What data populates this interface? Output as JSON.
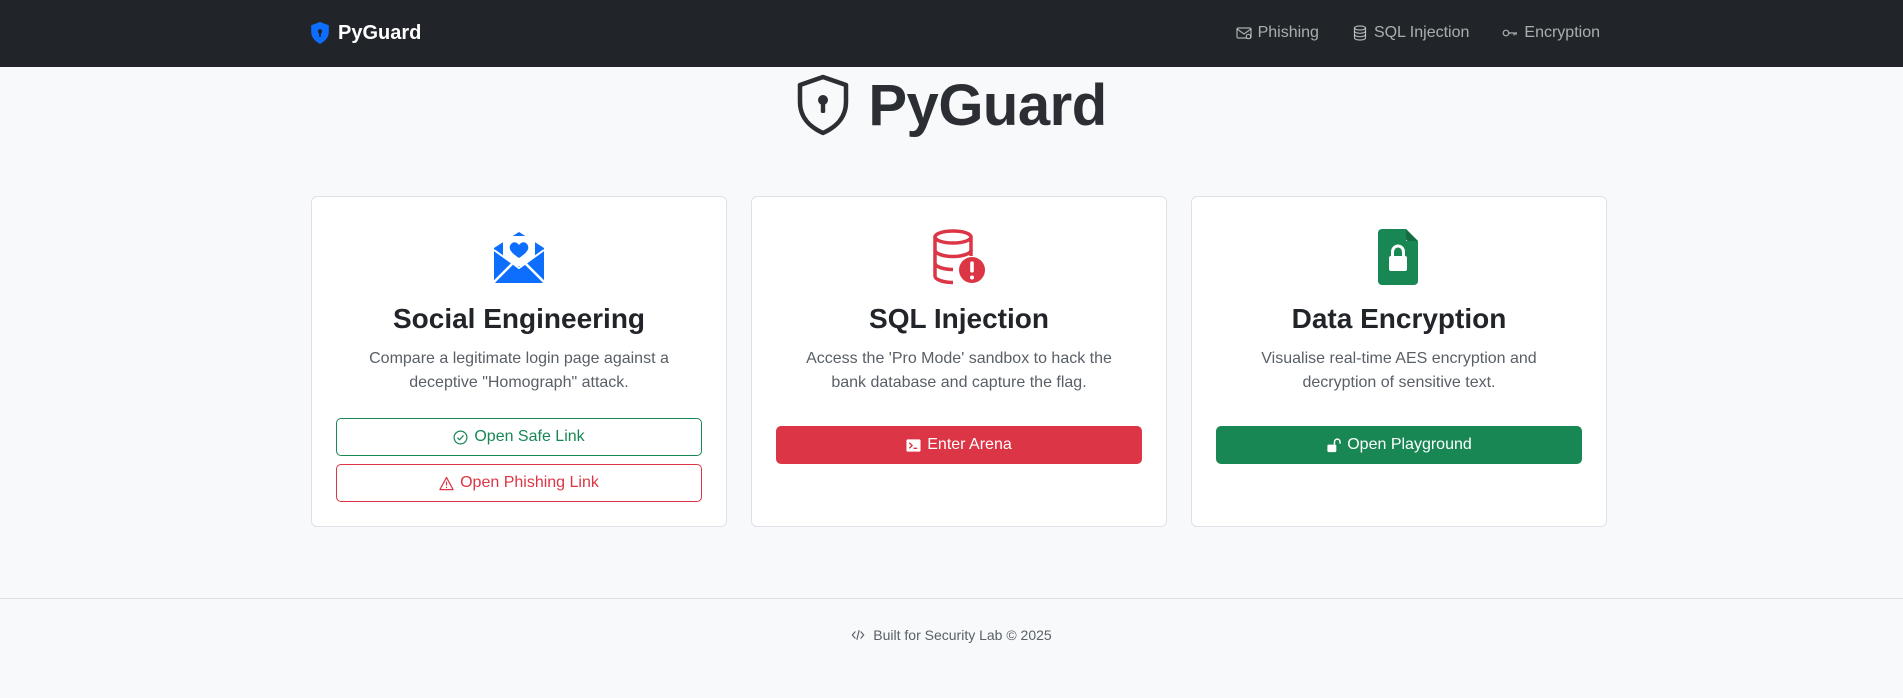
{
  "navbar": {
    "brand": "PyGuard",
    "links": [
      {
        "label": "Phishing",
        "icon": "envelope-icon"
      },
      {
        "label": "SQL Injection",
        "icon": "database-icon"
      },
      {
        "label": "Encryption",
        "icon": "key-icon"
      }
    ]
  },
  "hero": {
    "title": "PyGuard",
    "icon": "shield-lock-icon"
  },
  "cards": [
    {
      "title": "Social Engineering",
      "description": "Compare a legitimate login page against a deceptive \"Homograph\" attack.",
      "icon": "envelope-heart-icon",
      "icon_color": "#0d6efd",
      "buttons": [
        {
          "label": "Open Safe Link",
          "icon": "check-circle-icon"
        },
        {
          "label": "Open Phishing Link",
          "icon": "warning-icon"
        }
      ]
    },
    {
      "title": "SQL Injection",
      "description": "Access the 'Pro Mode' sandbox to hack the bank database and capture the flag.",
      "icon": "database-exclamation-icon",
      "icon_color": "#dc3545",
      "buttons": [
        {
          "label": "Enter Arena",
          "icon": "terminal-icon"
        }
      ]
    },
    {
      "title": "Data Encryption",
      "description": "Visualise real-time AES encryption and decryption of sensitive text.",
      "icon": "file-lock-icon",
      "icon_color": "#198754",
      "buttons": [
        {
          "label": "Open Playground",
          "icon": "unlock-icon"
        }
      ]
    }
  ],
  "footer": {
    "text": "Built for Security Lab © 2025",
    "icon": "code-icon"
  },
  "colors": {
    "primary": "#0d6efd",
    "danger": "#dc3545",
    "success": "#198754",
    "navbar_bg": "#212529",
    "page_bg": "#f8f9fa"
  }
}
